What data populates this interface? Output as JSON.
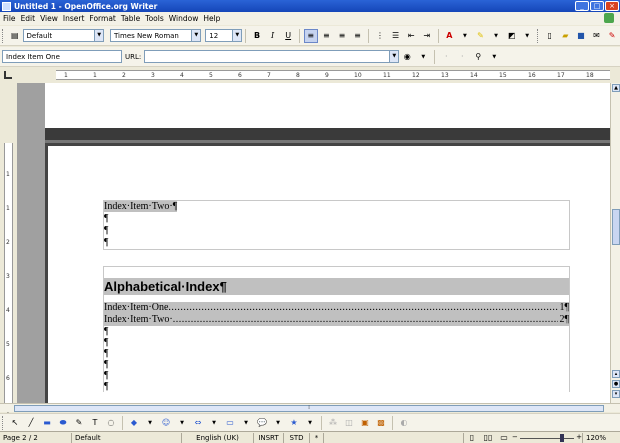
{
  "window": {
    "title": "Untitled 1 - OpenOffice.org Writer"
  },
  "menu": [
    "File",
    "Edit",
    "View",
    "Insert",
    "Format",
    "Table",
    "Tools",
    "Window",
    "Help"
  ],
  "formatting": {
    "paragraph_style": "Default",
    "font_name": "Times New Roman",
    "font_size": "12"
  },
  "hyperlink_bar": {
    "target_value": "Index Item One",
    "url_label": "URL:",
    "url_value": ""
  },
  "ruler": {
    "numbers": [
      "1",
      "1",
      "2",
      "3",
      "4",
      "5",
      "6",
      "7",
      "8",
      "9",
      "10",
      "11",
      "12",
      "13",
      "14",
      "15",
      "16",
      "17",
      "18"
    ]
  },
  "vertical_ruler": {
    "numbers": [
      "1",
      "1",
      "2",
      "3",
      "4",
      "5",
      "6",
      "7"
    ]
  },
  "document": {
    "frame_lines": [
      "Index·Item·Two·¶",
      "¶",
      "¶",
      "¶",
      "¶"
    ],
    "index_title": "Alphabetical·Index¶",
    "entries": [
      {
        "text": "Index·Item·One",
        "page": "1¶"
      },
      {
        "text": "Index·Item·Two·",
        "page": "2¶"
      }
    ],
    "trailing_marks": [
      "¶",
      "¶",
      "¶",
      "¶",
      "¶",
      "¶"
    ]
  },
  "status": {
    "page": "Page 2 / 2",
    "style": "Default",
    "language": "English (UK)",
    "insert_mode": "INSRT",
    "selection_mode": "STD",
    "modified": "*",
    "zoom": "120%"
  },
  "colors": {
    "title_bar": "#1e55c8",
    "field_shading": "#c0c0c0",
    "workspace": "#a0a0a0"
  }
}
